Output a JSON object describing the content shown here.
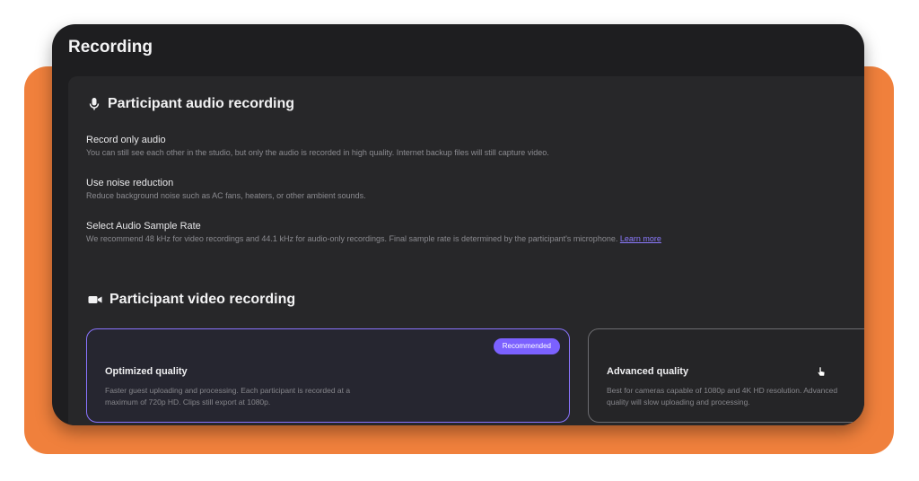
{
  "window": {
    "title": "Recording"
  },
  "audio_section": {
    "title": "Participant audio recording",
    "icon": "microphone-icon",
    "settings": [
      {
        "label": "Record only audio",
        "description": "You can still see each other in the studio, but only the audio is recorded in high quality. Internet backup files will still capture video."
      },
      {
        "label": "Use noise reduction",
        "description": "Reduce background noise such as AC fans, heaters, or other ambient sounds."
      },
      {
        "label": "Select Audio Sample Rate",
        "description": "We recommend 48 kHz for video recordings and 44.1 kHz for audio-only recordings. Final sample rate is determined by the participant's microphone.",
        "link": "Learn more"
      }
    ]
  },
  "video_section": {
    "title": "Participant video recording",
    "icon": "video-camera-icon",
    "options": [
      {
        "badge": "Recommended",
        "title": "Optimized quality",
        "description": "Faster guest uploading and processing. Each participant is recorded at a maximum of 720p HD. Clips still export at 1080p."
      },
      {
        "title": "Advanced quality",
        "description": "Best for cameras capable of 1080p and 4K HD resolution. Advanced quality will slow uploading and processing."
      }
    ]
  },
  "colors": {
    "accent": "#7b61ff",
    "background_orange": "#F0803C",
    "window": "#1e1e20",
    "panel": "#272729"
  }
}
